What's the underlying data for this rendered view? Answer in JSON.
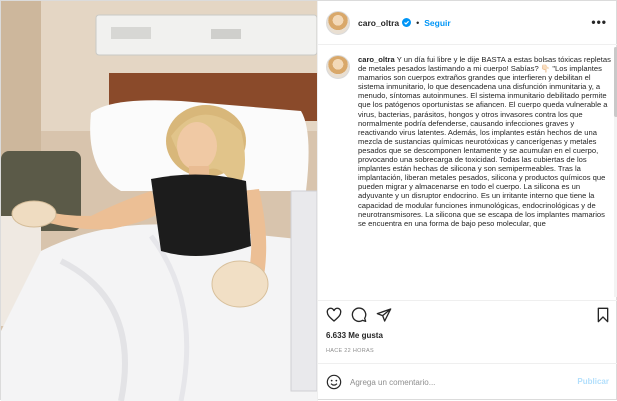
{
  "header": {
    "username": "caro_oltra",
    "separator": "•",
    "follow_label": "Seguir",
    "more_label": "•••",
    "verified_icon": "verified-badge-icon",
    "verified_color": "#0095f6"
  },
  "caption": {
    "username": "caro_oltra",
    "text": "Y un día fui libre y le dije BASTA a estas bolsas tóxicas repletas de metales pesados lastimando a mi cuerpo! Sabías? 👇🏻 \"Los implantes mamarios son cuerpos extraños grandes que interfieren y debilitan el sistema inmunitario, lo que desencadena una disfunción inmunitaria y, a menudo, síntomas autoinmunes. El sistema inmunitario debilitado permite que los patógenos oportunistas se afiancen. El cuerpo queda vulnerable a virus, bacterias, parásitos, hongos y otros invasores contra los que normalmente podría defenderse, causando infecciones graves y reactivando virus latentes. Además, los implantes están hechos de una mezcla de sustancias químicas neurotóxicas y cancerígenas y metales pesados que se descomponen lentamente y se acumulan en el cuerpo, provocando una sobrecarga de toxicidad. Todas las cubiertas de los implantes están hechas de silicona y son semipermeables. Tras la implantación, liberan metales pesados, silicona y productos químicos que pueden migrar y almacenarse en todo el cuerpo. La silicona es un adyuvante y un disruptor endocrino. Es un irritante interno que tiene la capacidad de modular funciones inmunológicas, endocrinológicas y de neurotransmisores. La silicona que se escapa de los implantes mamarios se encuentra en una forma de bajo peso molecular, que"
  },
  "actions": {
    "like_icon": "heart-icon",
    "comment_icon": "comment-bubble-icon",
    "share_icon": "paper-plane-icon",
    "save_icon": "bookmark-icon"
  },
  "likes_text": "6.633 Me gusta",
  "time_ago": "HACE 22 HORAS",
  "comment": {
    "emoji_icon": "smiley-icon",
    "placeholder": "Agrega un comentario...",
    "value": "",
    "publish_label": "Publicar",
    "publish_color": "#b2dffc"
  },
  "colors": {
    "accent": "#0095f6",
    "border": "#dbdbdb",
    "muted": "#8e8e8e"
  }
}
